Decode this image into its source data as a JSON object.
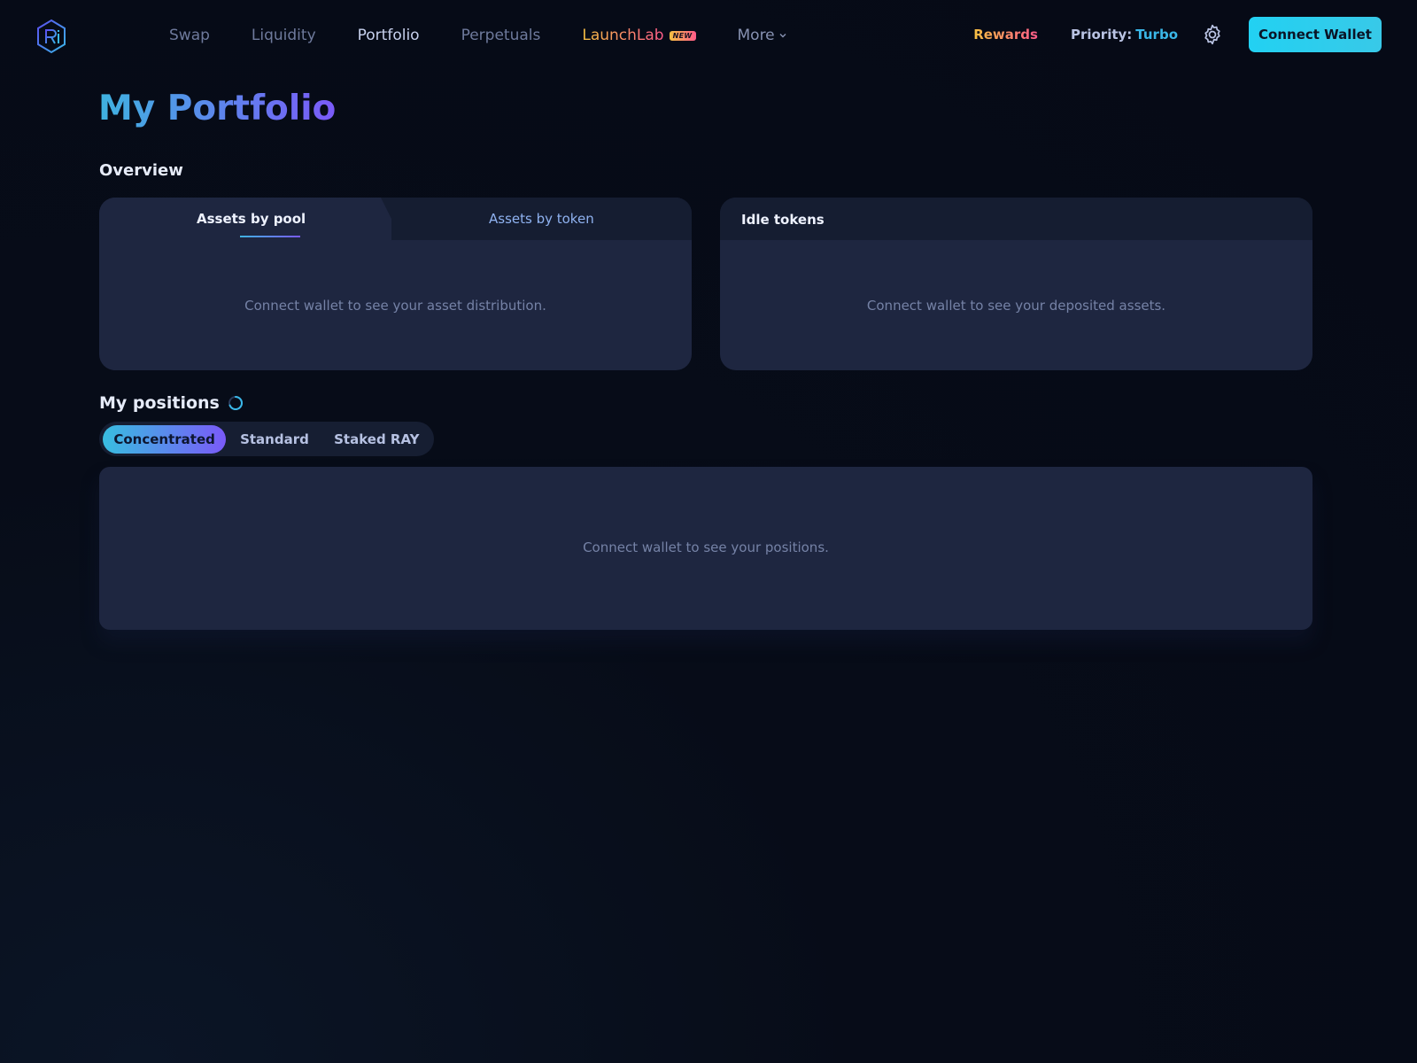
{
  "nav": {
    "items": [
      {
        "label": "Swap"
      },
      {
        "label": "Liquidity"
      },
      {
        "label": "Portfolio"
      },
      {
        "label": "Perpetuals"
      },
      {
        "label": "LaunchLab",
        "badge": "NEW"
      },
      {
        "label": "More"
      }
    ],
    "active": "Portfolio"
  },
  "header": {
    "rewards_label": "Rewards",
    "priority_label": "Priority:",
    "priority_value": "Turbo",
    "connect_label": "Connect Wallet"
  },
  "page": {
    "title": "My Portfolio",
    "overview_title": "Overview"
  },
  "overview": {
    "tabs": [
      "Assets by pool",
      "Assets by token"
    ],
    "active_tab": "Assets by pool",
    "assets_empty": "Connect wallet to see your asset distribution.",
    "idle_title": "Idle tokens",
    "idle_empty": "Connect wallet to see your deposited assets."
  },
  "positions": {
    "title": "My positions",
    "tabs": [
      "Concentrated",
      "Standard",
      "Staked RAY"
    ],
    "active_tab": "Concentrated",
    "empty": "Connect wallet to see your positions."
  },
  "colors": {
    "background": "#070c18",
    "card": "#1e2640",
    "accent_cyan": "#22d1f2",
    "accent_purple": "#7a5af8",
    "gold": "#f6c142",
    "pink": "#ff5a8a"
  }
}
